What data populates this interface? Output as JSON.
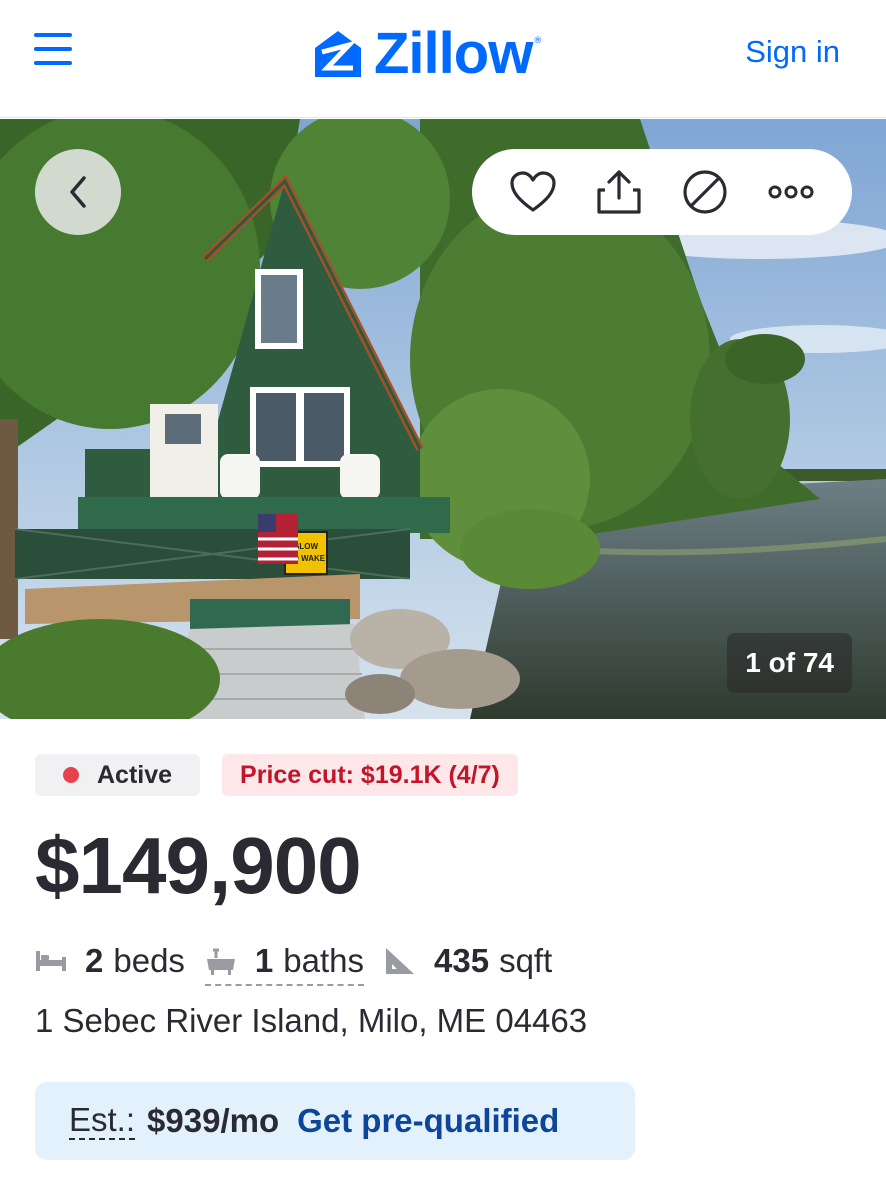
{
  "header": {
    "logo_text": "Zillow",
    "signin_label": "Sign in",
    "brand_color": "#006aff"
  },
  "photo": {
    "counter": "1 of 74",
    "sign_text": [
      "SLOW",
      "NO WAKE"
    ]
  },
  "actions": {
    "icons": [
      "heart-icon",
      "share-icon",
      "hide-icon",
      "more-icon"
    ]
  },
  "listing": {
    "status": "Active",
    "price_cut": "Price cut: $19.1K (4/7)",
    "price": "$149,900",
    "beds_value": "2",
    "beds_label": "beds",
    "baths_value": "1",
    "baths_label": "baths",
    "sqft_value": "435",
    "sqft_label": "sqft",
    "address": "1 Sebec River Island, Milo, ME 04463"
  },
  "estimate": {
    "label": "Est.:",
    "value": "$939/mo",
    "cta": "Get pre-qualified"
  }
}
